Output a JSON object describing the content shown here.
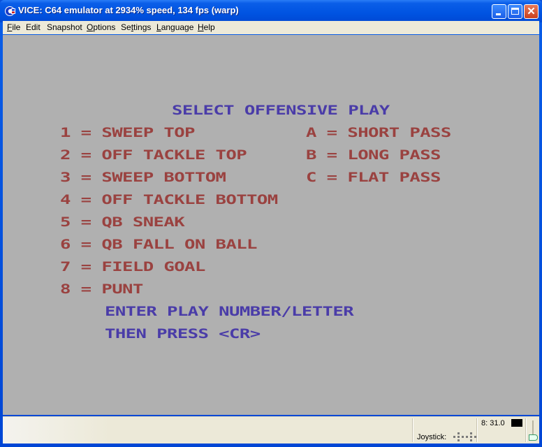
{
  "window": {
    "title": "VICE: C64 emulator at 2934% speed, 134 fps (warp)",
    "app_icon": "commodore-logo-icon",
    "controls": {
      "minimize": "minimize-icon",
      "maximize": "maximize-icon",
      "close": "close-icon"
    }
  },
  "menubar": {
    "items": [
      {
        "label": "File",
        "mnemonic": "F"
      },
      {
        "label": "Edit",
        "mnemonic": ""
      },
      {
        "label": "Snapshot",
        "mnemonic": ""
      },
      {
        "label": "Options",
        "mnemonic": "O"
      },
      {
        "label": "Settings",
        "mnemonic": "t"
      },
      {
        "label": "Language",
        "mnemonic": "L"
      },
      {
        "label": "Help",
        "mnemonic": "H"
      }
    ]
  },
  "c64_screen": {
    "colors": {
      "background": "#b0b0b0",
      "menu_text": "#9a4240",
      "prompt_text": "#4a3ca8"
    },
    "heading": "SELECT OFFENSIVE PLAY",
    "left_options": [
      {
        "key": "1",
        "label": "SWEEP TOP"
      },
      {
        "key": "2",
        "label": "OFF TACKLE TOP"
      },
      {
        "key": "3",
        "label": "SWEEP BOTTOM"
      },
      {
        "key": "4",
        "label": "OFF TACKLE BOTTOM"
      },
      {
        "key": "5",
        "label": "QB SNEAK"
      },
      {
        "key": "6",
        "label": "QB FALL ON BALL"
      },
      {
        "key": "7",
        "label": "FIELD GOAL"
      },
      {
        "key": "8",
        "label": "PUNT"
      }
    ],
    "right_options": [
      {
        "key": "A",
        "label": "SHORT PASS"
      },
      {
        "key": "B",
        "label": "LONG PASS"
      },
      {
        "key": "C",
        "label": "FLAT PASS"
      }
    ],
    "separator": "=",
    "prompt_line1": "ENTER PLAY NUMBER/LETTER",
    "prompt_line2": "THEN PRESS <CR>"
  },
  "statusbar": {
    "joystick_label": "Joystick:",
    "drive_status": "8: 31.0",
    "drive_led_color": "#000000"
  }
}
